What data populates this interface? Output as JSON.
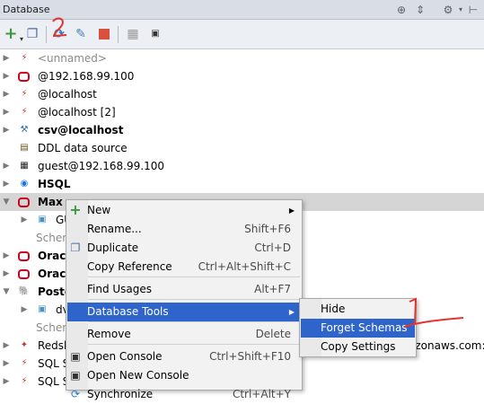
{
  "titlebar": {
    "title": "Database",
    "icons": [
      "target-icon",
      "split-icon",
      "gear-icon",
      "pin-icon"
    ]
  },
  "toolbar": {
    "icons": [
      "add-icon",
      "copy-icon",
      "sync-icon",
      "edit-properties-icon",
      "stop-icon",
      "table-icon",
      "console-icon"
    ]
  },
  "tree": [
    {
      "label": "<unnamed>",
      "style": "gray",
      "icon": "mysql-icon"
    },
    {
      "label": "@192.168.99.100",
      "style": "",
      "icon": "oracle-icon"
    },
    {
      "label": "@localhost",
      "style": "",
      "icon": "mysql-icon"
    },
    {
      "label": "@localhost [2]",
      "style": "",
      "icon": "mysql-icon"
    },
    {
      "label": "csv@localhost",
      "style": "bold",
      "icon": "csv-icon"
    },
    {
      "label": "DDL data source",
      "style": "",
      "icon": "ddl-icon"
    },
    {
      "label": "guest@192.168.99.100",
      "style": "",
      "icon": "db2-icon"
    },
    {
      "label": "HSQL",
      "style": "bold",
      "icon": "hsql-icon"
    },
    {
      "label": "Max",
      "style": "bold",
      "icon": "oracle-icon"
    },
    {
      "label": "GU",
      "style": "",
      "icon": "schema-icon"
    },
    {
      "label": "Schem",
      "style": "gray",
      "icon": ""
    },
    {
      "label": "Oracl",
      "style": "bold",
      "icon": "oracle-icon"
    },
    {
      "label": "Oracl",
      "style": "bold",
      "icon": "oracle-icon"
    },
    {
      "label": "Postg",
      "style": "bold",
      "icon": "postgres-icon"
    },
    {
      "label": "dv",
      "style": "",
      "icon": "schema-icon"
    },
    {
      "label": "Schem",
      "style": "gray",
      "icon": ""
    },
    {
      "label": "Redsh",
      "style": "",
      "icon": "redshift-icon"
    },
    {
      "label": "SQL S",
      "style": "",
      "icon": "sqlserver-icon"
    },
    {
      "label": "SQL S",
      "style": "",
      "icon": "sqlserver-icon"
    },
    {
      "label": "azonaws.com:5",
      "style": "",
      "icon": ""
    }
  ],
  "context_menu": {
    "items": [
      {
        "label": "New",
        "shortcut": "",
        "icon": "plus-icon",
        "submenu": true
      },
      {
        "label": "Rename...",
        "shortcut": "Shift+F6",
        "icon": "",
        "submenu": false
      },
      {
        "label": "Duplicate",
        "shortcut": "Ctrl+D",
        "icon": "duplicate-icon",
        "submenu": false
      },
      {
        "label": "Copy Reference",
        "shortcut": "Ctrl+Alt+Shift+C",
        "icon": "",
        "submenu": false
      },
      {
        "label": "Find Usages",
        "shortcut": "Alt+F7",
        "icon": "",
        "submenu": false
      },
      {
        "label": "Database Tools",
        "shortcut": "",
        "icon": "",
        "submenu": true
      },
      {
        "label": "Remove",
        "shortcut": "Delete",
        "icon": "",
        "submenu": false
      },
      {
        "label": "Open Console",
        "shortcut": "Ctrl+Shift+F10",
        "icon": "console-icon",
        "submenu": false
      },
      {
        "label": "Open New Console",
        "shortcut": "",
        "icon": "console-icon",
        "submenu": false
      },
      {
        "label": "Synchronize",
        "shortcut": "Ctrl+Alt+Y",
        "icon": "sync-icon",
        "submenu": false
      }
    ]
  },
  "submenu": {
    "items": [
      {
        "label": "Hide"
      },
      {
        "label": "Forget Schemas"
      },
      {
        "label": "Copy Settings"
      }
    ]
  },
  "annotations": {
    "first": "1",
    "second": "2"
  },
  "colors": {
    "highlight": "#2f65ca",
    "oracle_red": "#d0021b",
    "annotation_red": "#e3342f"
  }
}
